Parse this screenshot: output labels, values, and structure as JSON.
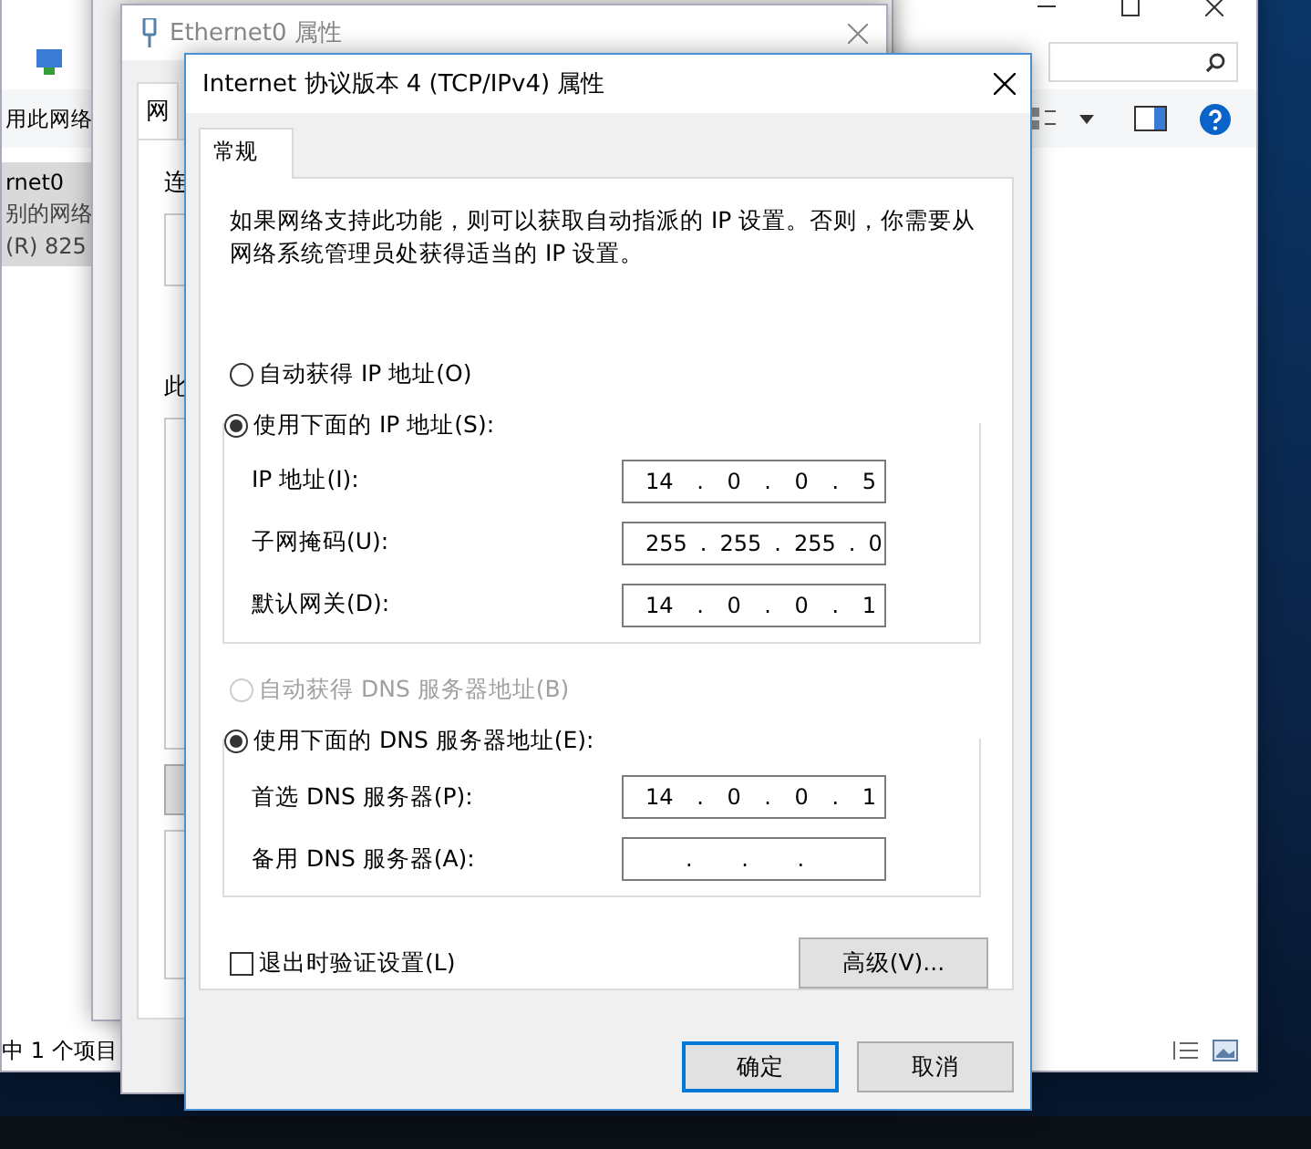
{
  "explorer": {
    "command": "用此网络",
    "items": [
      {
        "lines": [
          "rnet0",
          "别的网络",
          "(R) 825"
        ],
        "selected": true
      }
    ],
    "status": "中 1 个项目"
  },
  "ethernet_window": {
    "title": "Ethernet0 属性",
    "tab": "网",
    "labels": [
      "连",
      "此"
    ]
  },
  "dialog": {
    "title": "Internet 协议版本 4 (TCP/IPv4) 属性",
    "tabs": [
      {
        "label": "常规",
        "selected": true
      }
    ],
    "description": "如果网络支持此功能，则可以获取自动指派的 IP 设置。否则，你需要从网络系统管理员处获得适当的 IP 设置。",
    "ip_auto": {
      "label": "自动获得 IP 地址(O)",
      "selected": false,
      "disabled": false
    },
    "ip_manual": {
      "label": "使用下面的 IP 地址(S):",
      "selected": true,
      "disabled": false
    },
    "ip_fields": [
      {
        "label": "IP 地址(I):",
        "value": "14 . 0 . 0 . 5"
      },
      {
        "label": "子网掩码(U):",
        "value": "255 . 255 . 255 . 0"
      },
      {
        "label": "默认网关(D):",
        "value": "14 . 0 . 0 . 1"
      }
    ],
    "dns_auto": {
      "label": "自动获得 DNS 服务器地址(B)",
      "selected": false,
      "disabled": true
    },
    "dns_manual": {
      "label": "使用下面的 DNS 服务器地址(E):",
      "selected": true,
      "disabled": false
    },
    "dns_fields": [
      {
        "label": "首选 DNS 服务器(P):",
        "value": "14 . 0 . 0 . 1"
      },
      {
        "label": "备用 DNS 服务器(A):",
        "value": ". . ."
      }
    ],
    "validate": {
      "label": "退出时验证设置(L)",
      "checked": false
    },
    "advanced": "高级(V)...",
    "buttons": [
      {
        "label": "确定",
        "default": true
      },
      {
        "label": "取消",
        "default": false
      }
    ]
  }
}
